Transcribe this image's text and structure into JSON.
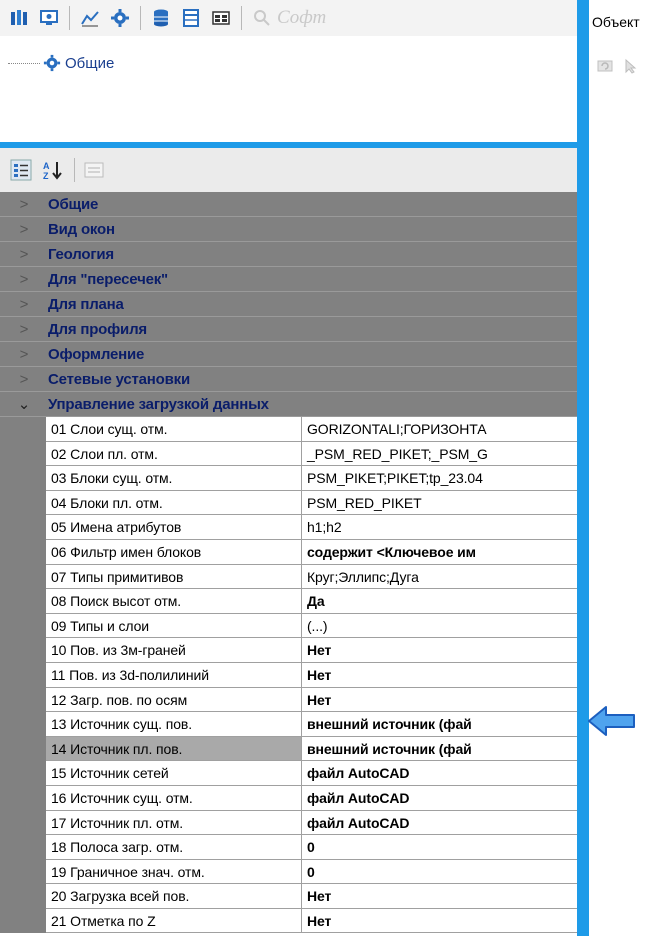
{
  "toolbar": {
    "search_placeholder": "Софт",
    "icons": [
      "columns-icon",
      "monitor-icon",
      "chart-icon",
      "gear-icon",
      "database-icon",
      "table-icon",
      "grid-icon",
      "search-icon"
    ]
  },
  "tree": {
    "root_label": "Общие"
  },
  "property_toolbar": {
    "sort_label": "A↓Z"
  },
  "categories": [
    {
      "label": "Общие",
      "expanded": false
    },
    {
      "label": "Вид окон",
      "expanded": false
    },
    {
      "label": "Геология",
      "expanded": false
    },
    {
      "label": "Для \"пересечек\"",
      "expanded": false
    },
    {
      "label": "Для плана",
      "expanded": false
    },
    {
      "label": "Для профиля",
      "expanded": false
    },
    {
      "label": "Оформление",
      "expanded": false
    },
    {
      "label": "Сетевые установки",
      "expanded": false
    },
    {
      "label": "Управление загрузкой данных",
      "expanded": true
    }
  ],
  "properties": [
    {
      "name": "01 Слои сущ. отм.",
      "value": "GORIZONTALI;ГОРИЗОНТА",
      "bold": false
    },
    {
      "name": "02 Слои пл. отм.",
      "value": "_PSM_RED_PIKET;_PSM_G",
      "bold": false
    },
    {
      "name": "03 Блоки сущ. отм.",
      "value": "PSM_PIKET;PIKET;tp_23.04",
      "bold": false
    },
    {
      "name": "04 Блоки пл. отм.",
      "value": "PSM_RED_PIKET",
      "bold": false
    },
    {
      "name": "05 Имена атрибутов",
      "value": "h1;h2",
      "bold": false
    },
    {
      "name": "06 Фильтр имен блоков",
      "value": "содержит <Ключевое им",
      "bold": true
    },
    {
      "name": "07 Типы примитивов",
      "value": "Круг;Эллипс;Дуга",
      "bold": false
    },
    {
      "name": "08 Поиск высот отм.",
      "value": "Да",
      "bold": true
    },
    {
      "name": "09 Типы и слои",
      "value": "(...)",
      "bold": false
    },
    {
      "name": "10 Пов. из 3м-граней",
      "value": "Нет",
      "bold": true
    },
    {
      "name": "11 Пов. из 3d-полилиний",
      "value": "Нет",
      "bold": true
    },
    {
      "name": "12 Загр. пов. по осям",
      "value": "Нет",
      "bold": true
    },
    {
      "name": "13 Источник сущ. пов.",
      "value": "внешний источник (фай",
      "bold": true
    },
    {
      "name": "14 Источник пл. пов.",
      "value": "внешний источник (фай",
      "bold": true,
      "selected": true
    },
    {
      "name": "15 Источник сетей",
      "value": "файл AutoCAD",
      "bold": true
    },
    {
      "name": "16 Источник сущ. отм.",
      "value": "файл AutoCAD",
      "bold": true
    },
    {
      "name": "17 Источник пл. отм.",
      "value": "файл AutoCAD",
      "bold": true
    },
    {
      "name": "18 Полоса загр. отм.",
      "value": "0",
      "bold": true
    },
    {
      "name": "19 Граничное знач. отм.",
      "value": "0",
      "bold": true
    },
    {
      "name": "20 Загрузка всей пов.",
      "value": "Нет",
      "bold": true
    },
    {
      "name": "21 Отметка по Z",
      "value": "Нет",
      "bold": true
    }
  ],
  "right_panel": {
    "title": "Объект",
    "icons": [
      "refresh-icon",
      "cursor-icon"
    ]
  },
  "colors": {
    "accent": "#1e9be8",
    "category_bg": "#818181",
    "category_text": "#0a1d6a",
    "arrow": "#3a8fe0"
  }
}
